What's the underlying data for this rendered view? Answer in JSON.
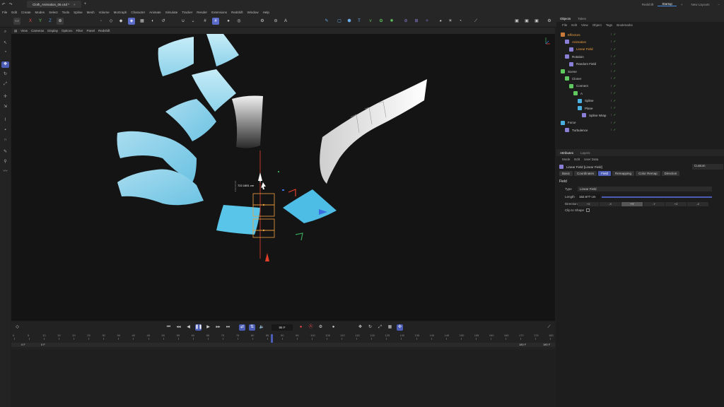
{
  "titlebar": {
    "doc_tab": "Cloth_Animation_06.c4d *",
    "right_tabs": [
      "Redshift",
      "Startup"
    ],
    "new_layouts": "New Layouts"
  },
  "menubar": [
    "File",
    "Edit",
    "Create",
    "Modes",
    "Select",
    "Tools",
    "Spline",
    "Mesh",
    "Volume",
    "MoGraph",
    "Character",
    "Animate",
    "Simulate",
    "Tracker",
    "Render",
    "Extensions",
    "Redshift",
    "Window",
    "Help"
  ],
  "viewport": {
    "menu": [
      "View",
      "Cameras",
      "Display",
      "Options",
      "Filter",
      "Panel",
      "Redshift"
    ],
    "measure": "722.1651 cm"
  },
  "timeline": {
    "current_frame": "86 F",
    "ticks": [
      "0",
      "5",
      "10",
      "15",
      "20",
      "25",
      "30",
      "35",
      "40",
      "45",
      "50",
      "55",
      "60",
      "65",
      "70",
      "75",
      "80",
      "85",
      "90",
      "95",
      "100",
      "105",
      "110",
      "115",
      "120",
      "125",
      "130",
      "135",
      "140",
      "145",
      "150",
      "155",
      "160",
      "165",
      "170",
      "175",
      "180"
    ],
    "range_start": "0 F",
    "range_start2": "0 F",
    "range_end": "180 F",
    "range_end2": "180 F"
  },
  "objects_panel": {
    "tabs": [
      "Objects",
      "Takes"
    ],
    "menu": [
      "File",
      "Edit",
      "View",
      "Object",
      "Tags",
      "Bookmarks"
    ],
    "items": [
      {
        "name": "Effectors",
        "indent": 0,
        "color": "#c97a3a",
        "orange": true
      },
      {
        "name": "Animation",
        "indent": 1,
        "color": "#8a7fd6",
        "orange": true
      },
      {
        "name": "Linear Field",
        "indent": 2,
        "color": "#8a7fd6",
        "orange": true
      },
      {
        "name": "Rotation",
        "indent": 1,
        "color": "#8a7fd6",
        "orange": false
      },
      {
        "name": "Random Field",
        "indent": 2,
        "color": "#8a7fd6",
        "orange": false
      },
      {
        "name": "Scene",
        "indent": 0,
        "color": "#5fc85f",
        "orange": false
      },
      {
        "name": "Cloner",
        "indent": 1,
        "color": "#5fc85f",
        "orange": false
      },
      {
        "name": "Connect",
        "indent": 2,
        "color": "#5fc85f",
        "orange": false
      },
      {
        "name": "A",
        "indent": 3,
        "color": "#5fc85f",
        "orange": false
      },
      {
        "name": "Spline",
        "indent": 4,
        "color": "#4ab0e0",
        "orange": false
      },
      {
        "name": "Plane",
        "indent": 4,
        "color": "#4ab0e0",
        "orange": false
      },
      {
        "name": "Spline Wrap",
        "indent": 5,
        "color": "#8a7fd6",
        "orange": false
      },
      {
        "name": "Force",
        "indent": 0,
        "color": "#4ab0e0",
        "orange": false
      },
      {
        "name": "Turbulence",
        "indent": 1,
        "color": "#8a7fd6",
        "orange": false
      }
    ]
  },
  "attributes_panel": {
    "tabs": [
      "Attributes",
      "Layers"
    ],
    "menu": [
      "Mode",
      "Edit",
      "User Data"
    ],
    "object_title": "Linear Field [Linear Field]",
    "preset": "Custom",
    "sub_tabs": [
      "Basic",
      "Coordinates",
      "Field",
      "Remapping",
      "Color Remap",
      "Direction"
    ],
    "active_sub_tab": "Field",
    "section": "Field",
    "type_label": "Type",
    "type_value": "Linear Field",
    "length_label": "Length",
    "length_value": "162.677 cm",
    "direction_label": "Direction",
    "direction_options": [
      "+X",
      "-X",
      "+Y",
      "-Y",
      "+Z",
      "-Z"
    ],
    "direction_active": "+Y",
    "clip_label": "Clip to Shape"
  }
}
